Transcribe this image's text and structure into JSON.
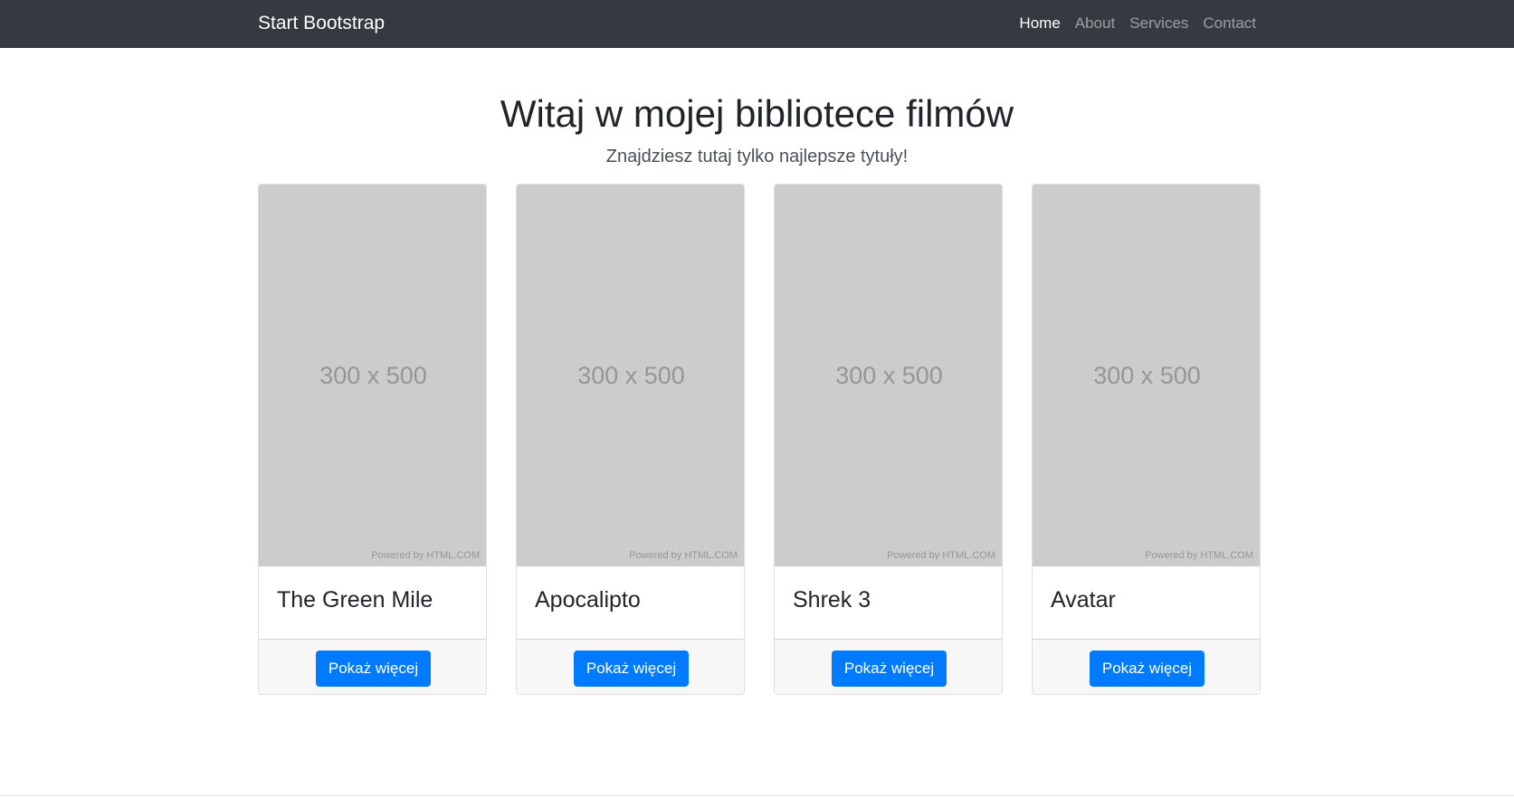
{
  "navbar": {
    "brand": "Start Bootstrap",
    "links": [
      {
        "label": "Home",
        "active": true
      },
      {
        "label": "About",
        "active": false
      },
      {
        "label": "Services",
        "active": false
      },
      {
        "label": "Contact",
        "active": false
      }
    ]
  },
  "hero": {
    "title": "Witaj w mojej bibliotece filmów",
    "subtitle": "Znajdziesz tutaj tylko najlepsze tytuły!"
  },
  "cards": [
    {
      "image_text": "300 x 500",
      "image_credit": "Powered by HTML.COM",
      "title": "The Green Mile",
      "button": "Pokaż więcej"
    },
    {
      "image_text": "300 x 500",
      "image_credit": "Powered by HTML.COM",
      "title": "Apocalipto",
      "button": "Pokaż więcej"
    },
    {
      "image_text": "300 x 500",
      "image_credit": "Powered by HTML.COM",
      "title": "Shrek 3",
      "button": "Pokaż więcej"
    },
    {
      "image_text": "300 x 500",
      "image_credit": "Powered by HTML.COM",
      "title": "Avatar",
      "button": "Pokaż więcej"
    }
  ],
  "colors": {
    "navbar_bg": "#343a40",
    "primary": "#007bff",
    "placeholder_bg": "#cccccc",
    "footer_bg": "#f7f7f7"
  }
}
